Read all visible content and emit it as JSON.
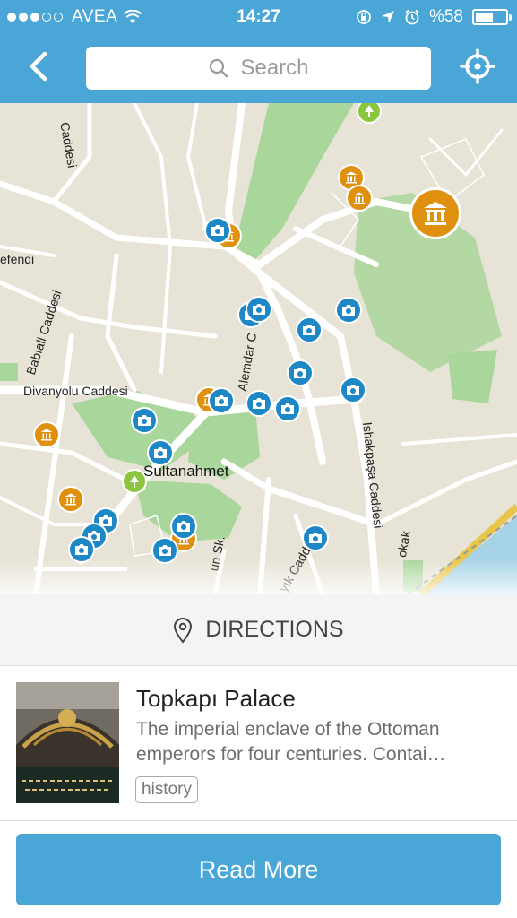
{
  "status": {
    "carrier": "AVEA",
    "time": "14:27",
    "battery": "%58",
    "battery_level": 0.58
  },
  "nav": {
    "search_placeholder": "Search",
    "back_icon": "chevron-left-icon",
    "locate_icon": "crosshair-icon"
  },
  "map": {
    "labels": {
      "caddesi_top": "Caddesi",
      "efendi": "efendi",
      "babiali": "Babıali Caddesi",
      "divanyolu": "Divanyolu Caddesi",
      "alemdar": "Alemdar C",
      "sultanahmet": "Sultanahmet",
      "ishakpasa": "Ishakpaşa Caddesi",
      "un_sk": "un Sk.",
      "yik_cadde": "yık Cadde",
      "okak": "okak"
    },
    "colors": {
      "photo": "#1e88c7",
      "museum": "#e0900f",
      "park": "#8cc63f"
    }
  },
  "directions": {
    "label": "DIRECTIONS",
    "icon": "map-pin-icon"
  },
  "place": {
    "title": "Topkapı Palace",
    "description_line1": "The imperial enclave of the Ottoman",
    "description_line2": "emperors for four centuries. Contai…",
    "tag": "history"
  },
  "actions": {
    "read_more": "Read More"
  },
  "colors": {
    "accent": "#4aa6d6"
  }
}
